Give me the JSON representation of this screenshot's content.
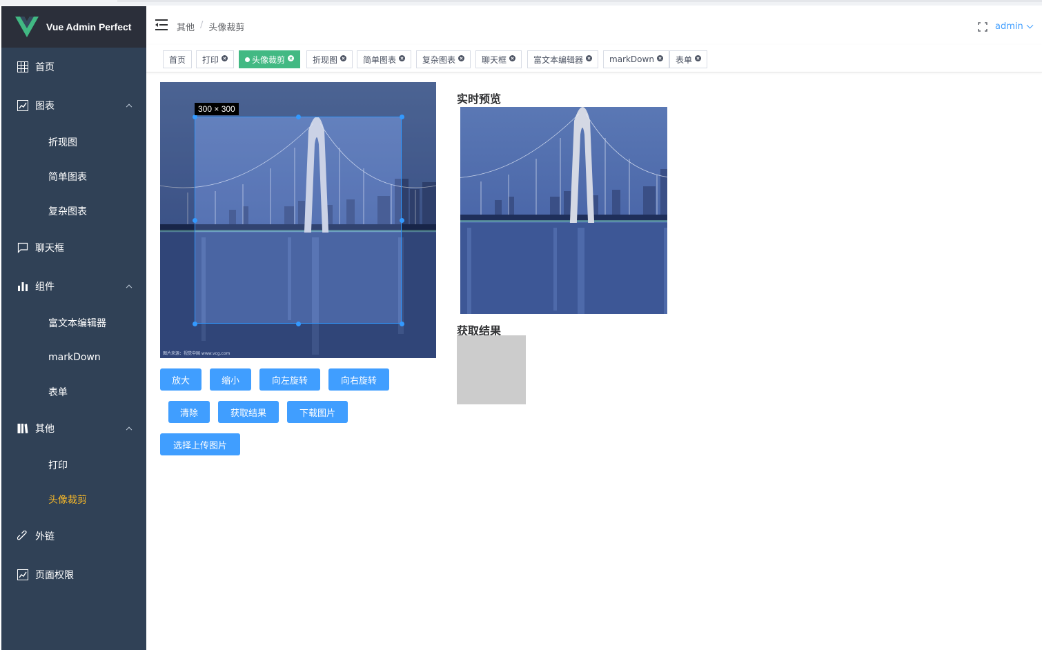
{
  "app": {
    "title": "Vue Admin Perfect",
    "accent": "#409eff",
    "sidebar_bg": "#304156",
    "active_color": "#f4b72a",
    "tag_active_color": "#42b983"
  },
  "sidebar": {
    "items": [
      {
        "label": "首页",
        "icon": "grid-icon"
      },
      {
        "label": "图表",
        "icon": "chart-line-icon"
      },
      {
        "label": "折现图"
      },
      {
        "label": "简单图表"
      },
      {
        "label": "复杂图表"
      },
      {
        "label": "聊天框",
        "icon": "chat-icon"
      },
      {
        "label": "组件",
        "icon": "bar-chart-icon"
      },
      {
        "label": "富文本编辑器"
      },
      {
        "label": "markDown"
      },
      {
        "label": "表单"
      },
      {
        "label": "其他",
        "icon": "book-icon"
      },
      {
        "label": "打印"
      },
      {
        "label": "头像裁剪"
      },
      {
        "label": "外链",
        "icon": "link-icon"
      },
      {
        "label": "页面权限",
        "icon": "chart-line-icon"
      }
    ],
    "active": "头像裁剪"
  },
  "header": {
    "breadcrumb": [
      "其他",
      "头像裁剪"
    ],
    "breadcrumb_sep": "/",
    "user": "admin"
  },
  "tags": [
    {
      "label": "首页",
      "closable": false
    },
    {
      "label": "打印",
      "closable": true
    },
    {
      "label": "头像裁剪",
      "closable": true,
      "active": true
    },
    {
      "label": "折现图",
      "closable": true
    },
    {
      "label": "简单图表",
      "closable": true
    },
    {
      "label": "复杂图表",
      "closable": true
    },
    {
      "label": "聊天框",
      "closable": true
    },
    {
      "label": "富文本编辑器",
      "closable": true
    },
    {
      "label": "markDown",
      "closable": true
    },
    {
      "label": "表单",
      "closable": true
    }
  ],
  "cropper": {
    "size_label": "300 × 300",
    "watermark": "图片来源：视觉中国 www.vcg.com"
  },
  "buttons": {
    "zoom_in": "放大",
    "zoom_out": "缩小",
    "rotate_left": "向左旋转",
    "rotate_right": "向右旋转",
    "clear": "清除",
    "get_result": "获取结果",
    "download": "下载图片",
    "upload": "选择上传图片"
  },
  "preview": {
    "title": "实时预览",
    "result_title": "获取结果"
  }
}
